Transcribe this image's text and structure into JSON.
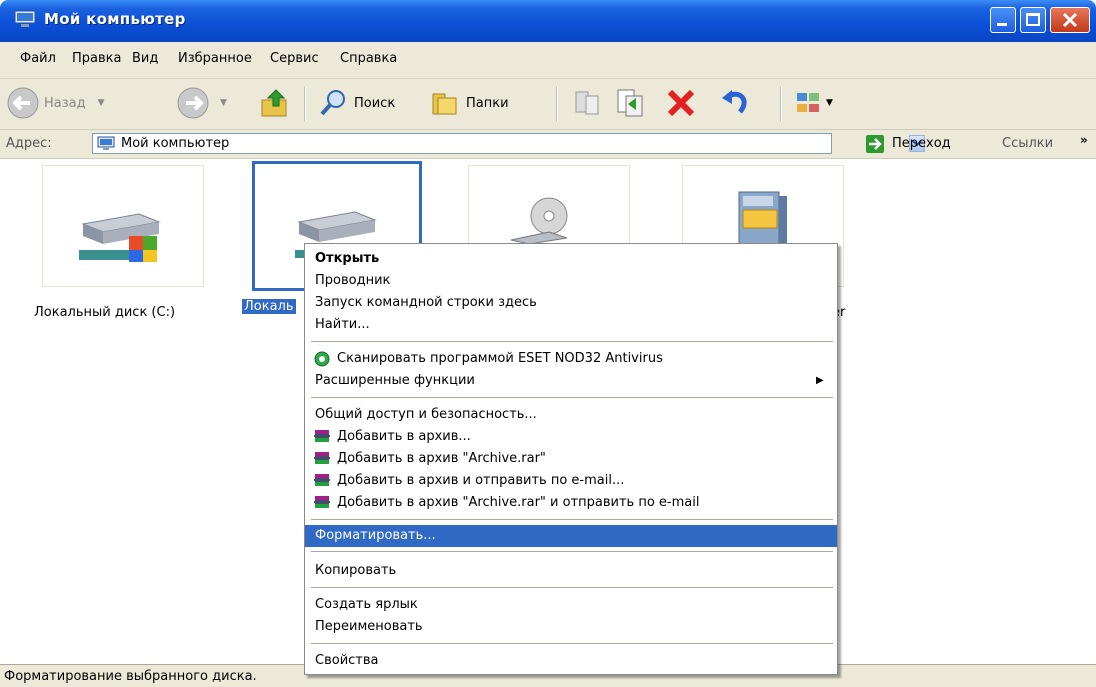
{
  "window": {
    "title": "Мой компьютер"
  },
  "menu": [
    "Файл",
    "Правка",
    "Вид",
    "Избранное",
    "Сервис",
    "Справка"
  ],
  "toolbar": {
    "back": "Назад",
    "search": "Поиск",
    "folders": "Папки"
  },
  "address": {
    "label": "Адрес:",
    "value": "Мой компьютер",
    "go": "Переход",
    "links": "Ссылки",
    "chevron": "»"
  },
  "items": [
    {
      "label": "Локальный диск (C:)"
    },
    {
      "label": "Локаль"
    },
    {
      "label": ""
    },
    {
      "label": "er"
    }
  ],
  "context_menu": {
    "open": "Открыть",
    "explorer": "Проводник",
    "cmd_here": "Запуск командной строки здесь",
    "find": "Найти...",
    "eset_scan": "Сканировать программой ESET NOD32 Antivirus",
    "advanced": "Расширенные функции",
    "sharing": "Общий доступ и безопасность...",
    "add_archive": "Добавить в архив...",
    "add_archive_rar": "Добавить в архив \"Archive.rar\"",
    "add_archive_email": "Добавить в архив и отправить по e-mail...",
    "add_archive_rar_email": "Добавить в архив \"Archive.rar\" и отправить по e-mail",
    "format": "Форматировать...",
    "copy": "Копировать",
    "create_shortcut": "Создать ярлык",
    "rename": "Переименовать",
    "properties": "Свойства"
  },
  "status": "Форматирование выбранного диска.",
  "colors": {
    "titlebar": "#0b4fd6",
    "selection": "#316ac5",
    "chrome": "#ece9d8"
  }
}
